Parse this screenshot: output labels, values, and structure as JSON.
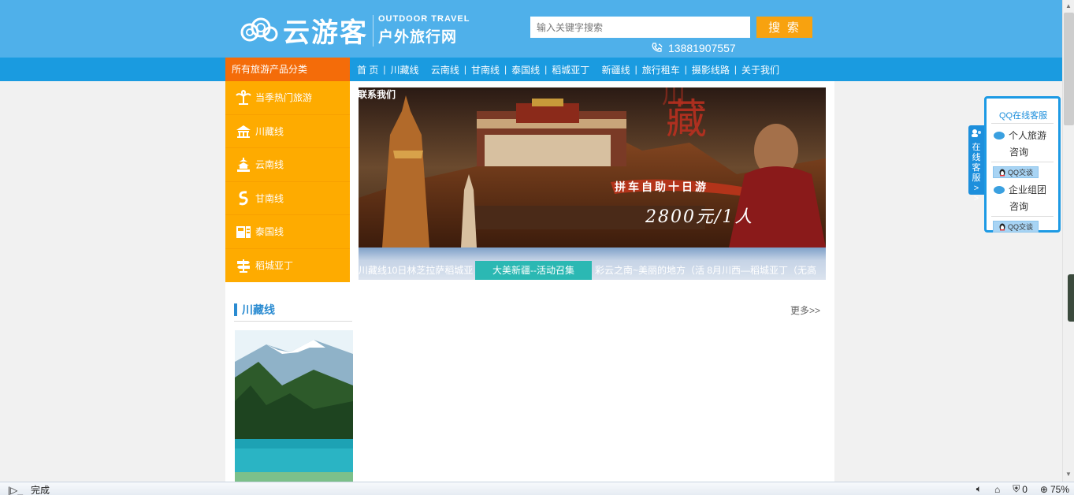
{
  "header": {
    "logo_text": "云游客",
    "logo_sub_en": "OUTDOOR TRAVEL",
    "logo_sub_cn": "户外旅行网",
    "search_placeholder": "输入关键字搜索",
    "search_button": "搜 索",
    "phone": "13881907557"
  },
  "nav": {
    "category_label": "所有旅游产品分类",
    "items": [
      "首 页",
      "川藏线",
      "云南线",
      "甘南线",
      "泰国线",
      "稻城亚丁",
      "新疆线",
      "旅行租车",
      "摄影线路",
      "关于我们"
    ]
  },
  "sidebar": {
    "items": [
      {
        "label": "当季热门旅游",
        "icon": "palm-tree-icon"
      },
      {
        "label": "川藏线",
        "icon": "temple-icon"
      },
      {
        "label": "云南线",
        "icon": "pagoda-icon"
      },
      {
        "label": "甘南线",
        "icon": "spiral-icon"
      },
      {
        "label": "泰国线",
        "icon": "passport-icon"
      },
      {
        "label": "稻城亚丁",
        "icon": "signpost-icon"
      }
    ]
  },
  "banner": {
    "contact_link": "联系我们",
    "slogan": "拼车自助十日游",
    "price": "2800元/1人",
    "tabs": [
      "川藏线10日林芝拉萨稻城亚",
      "大美新疆--活动召集",
      "彩云之南~美丽的地方（活 8月川西—稻城亚丁（无高"
    ]
  },
  "section": {
    "title": "川藏线",
    "more": "更多>>"
  },
  "qq": {
    "tab_label": "在线客服>>",
    "title": "QQ在线客服",
    "row1_a": "个人旅游",
    "row1_b": "咨询",
    "row2_a": "企业组团",
    "row2_b": "咨询",
    "btn": "QQ交谈"
  },
  "statusbar": {
    "status": "完成",
    "protected_count": "0",
    "zoom": "75%"
  },
  "colors": {
    "header_blue": "#4fb0ea",
    "nav_blue": "#1a9be0",
    "accent_orange": "#feab00",
    "category_orange": "#f46c09"
  }
}
